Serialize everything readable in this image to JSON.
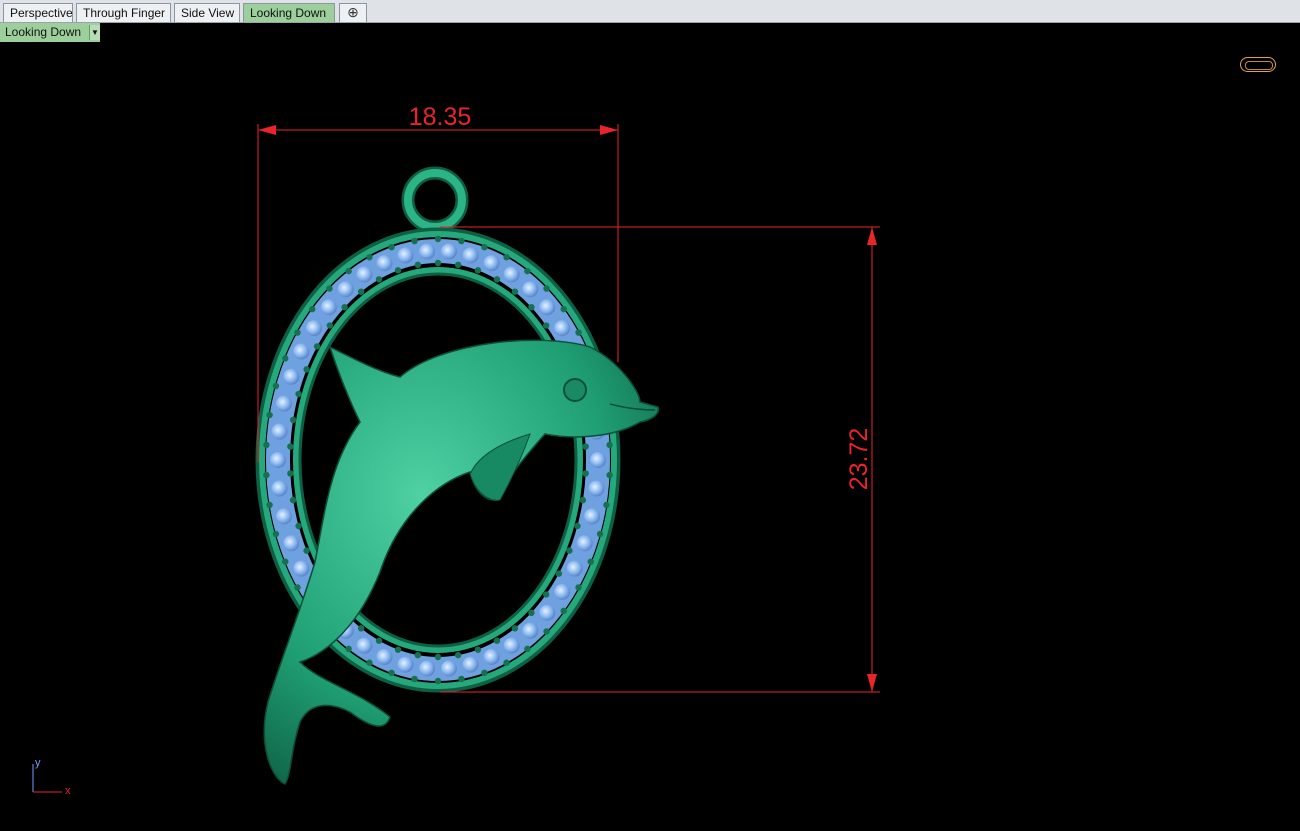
{
  "tabs": [
    {
      "label": "Perspective",
      "active": false
    },
    {
      "label": "Through Finger",
      "active": false
    },
    {
      "label": "Side View",
      "active": false
    },
    {
      "label": "Looking Down",
      "active": true
    }
  ],
  "add_tab_icon": "plus-icon",
  "viewport": {
    "title": "Looking Down",
    "dropdown_icon": "chevron-down-icon"
  },
  "dimensions": {
    "width": "18.35",
    "height": "23.72",
    "color": "#e8252a"
  },
  "axes": {
    "x_label": "x",
    "y_label": "y"
  },
  "model": {
    "body_color": "#1f9e74",
    "stone_color": "#8ab8f0",
    "prong_color": "#17704f"
  }
}
